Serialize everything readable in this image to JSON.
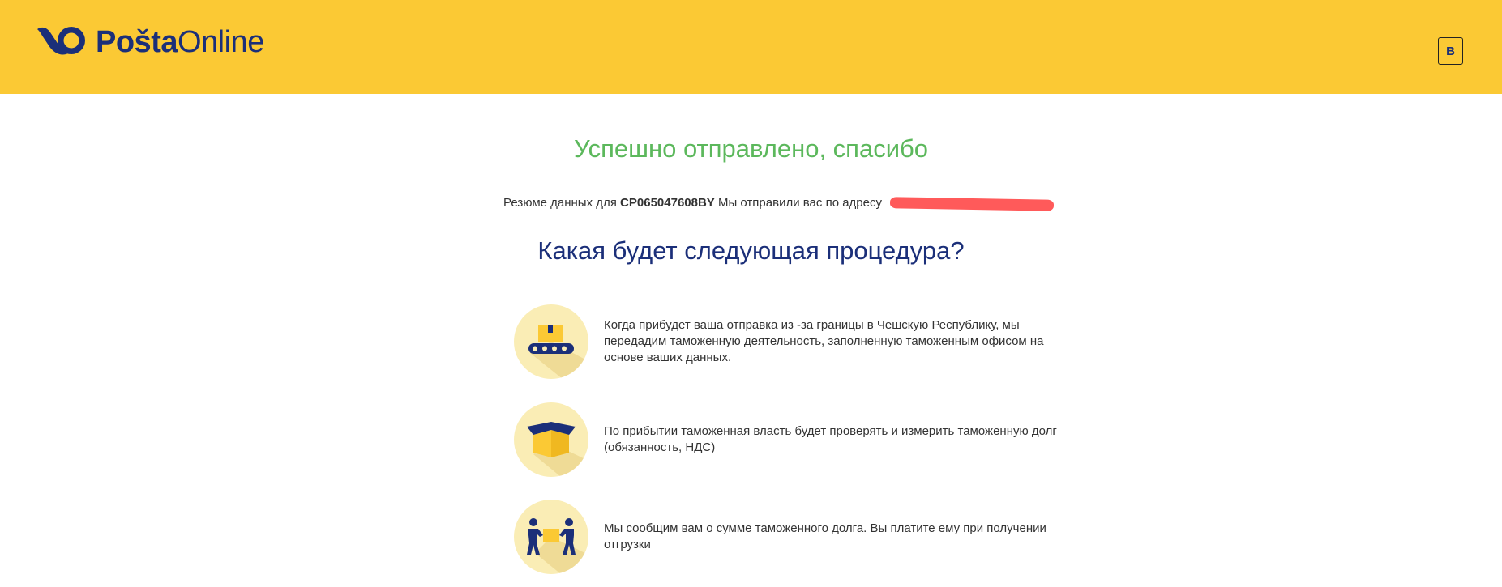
{
  "header": {
    "logo": {
      "part1": "Pošta",
      "part2": "Online"
    },
    "language_button": "B",
    "colors": {
      "background": "#fbc934",
      "brand": "#1b2f79"
    }
  },
  "main": {
    "title": "Успешно отправлено, спасибо",
    "summary": {
      "prefix": "Резюме данных для ",
      "tracking_number": "CP065047608BY",
      "suffix": " Мы отправили вас по адресу"
    },
    "subtitle": "Какая будет следующая процедура?",
    "steps": [
      {
        "icon": "conveyor-package-icon",
        "text": "Когда прибудет ваша отправка из -за границы в Чешскую Республику, мы передадим таможенную деятельность, заполненную таможенным офисом на основе ваших данных."
      },
      {
        "icon": "open-box-icon",
        "text": "По прибытии таможенная власть будет проверять и измерить таможенную долг (обязанность, НДС)"
      },
      {
        "icon": "people-carrying-box-icon",
        "text": "Мы сообщим вам о сумме таможенного долга. Вы платите ему при получении отгрузки"
      }
    ],
    "colors": {
      "title": "#5cb85c",
      "subtitle": "#1b2f79",
      "icon_circle": "#faedb5",
      "accent": "#fbc934"
    }
  }
}
